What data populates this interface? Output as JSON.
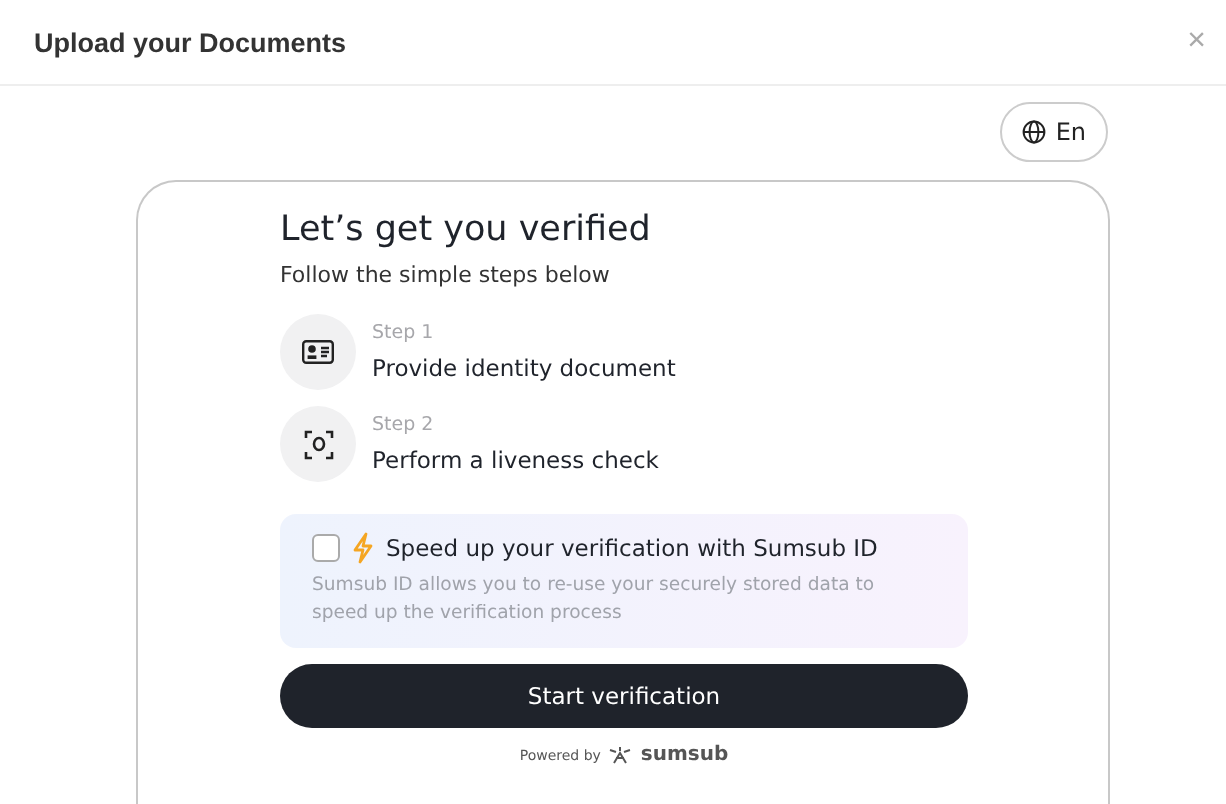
{
  "dialog": {
    "title": "Upload your Documents",
    "close": "×"
  },
  "language": {
    "label": "En"
  },
  "card": {
    "heading": "Let’s get you verified",
    "subtitle": "Follow the simple steps below",
    "steps": [
      {
        "kind": "document",
        "label": "Step 1",
        "text": "Provide identity document"
      },
      {
        "kind": "liveness",
        "label": "Step 2",
        "text": "Perform a liveness check"
      }
    ],
    "promo": {
      "checked": false,
      "title": "Speed up your verification with Sumsub ID",
      "description": "Sumsub ID allows you to re-use your securely stored data to speed up the verification process"
    },
    "button": "Start verification",
    "footer": {
      "powered_by": "Powered by",
      "brand": "sumsub"
    }
  }
}
